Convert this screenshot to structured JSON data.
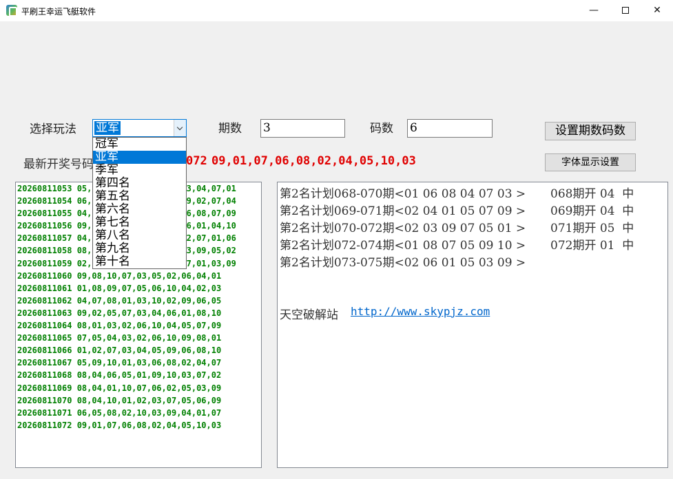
{
  "window": {
    "title": "平刷王幸运飞艇软件",
    "minimize_glyph": "—",
    "close_glyph": "✕"
  },
  "controls": {
    "play_label": "选择玩法",
    "play_selected": "亚军",
    "play_options": [
      "冠军",
      "亚军",
      "季军",
      "第四名",
      "第五名",
      "第六名",
      "第七名",
      "第八名",
      "第九名",
      "第十名"
    ],
    "periods_label": "期数",
    "periods_value": "3",
    "codes_label": "码数",
    "codes_value": "6",
    "set_button": "设置期数码数",
    "font_button": "字体显示设置"
  },
  "latest": {
    "label": "最新开奖号码",
    "issue_tail": "072",
    "numbers": "09,01,07,06,08,02,04,05,10,03",
    "color": "#e00000"
  },
  "history": [
    "20260811053 05,06,09,10,08,01,02,03,04,07,01",
    "20260811054 06,07,10,05,03,01,08,09,02,07,04",
    "20260811055 04,10,01,02,03,05,09,06,08,07,09",
    "20260811056 09,05,07,08,03,02,09,06,01,04,10",
    "20260811057 04,03,08,05,06,09,10,02,07,01,06",
    "20260811058 08,01,04,06,07,10,02,03,09,05,02",
    "20260811059 02,06,04,05,08,10,06,07,01,03,09",
    "20260811060 09,08,10,07,03,05,02,06,04,01",
    "20260811061 01,08,09,07,05,06,10,04,02,03",
    "20260811062 04,07,08,01,03,10,02,09,06,05",
    "20260811063 09,02,05,07,03,04,06,01,08,10",
    "20260811064 08,01,03,02,06,10,04,05,07,09",
    "20260811065 07,05,04,03,02,06,10,09,08,01",
    "20260811066 01,02,07,03,04,05,09,06,08,10",
    "20260811067 05,09,10,01,03,06,08,02,04,07",
    "20260811068 08,04,06,05,01,09,10,03,07,02",
    "20260811069 08,04,01,10,07,06,02,05,03,09",
    "20260811070 08,04,10,01,02,03,07,05,06,09",
    "20260811071 06,05,08,02,10,03,09,04,01,07",
    "20260811072 09,01,07,06,08,02,04,05,10,03"
  ],
  "history_color": "#008000",
  "plans": [
    {
      "plan": "第2名计划068-070期<01 06 08 04 07 03 >",
      "result": "068期开 04  中"
    },
    {
      "plan": "第2名计划069-071期<02 04 01 05 07 09 >",
      "result": "069期开 04  中"
    },
    {
      "plan": "第2名计划070-072期<02 03 09 07 05 01 >",
      "result": "071期开 05  中"
    },
    {
      "plan": "第2名计划072-074期<01 08 07 05 09 10 >",
      "result": "072期开 01  中"
    },
    {
      "plan": "第2名计划073-075期<02 06 01 05 03 09 >",
      "result": ""
    }
  ],
  "footer": {
    "label": "天空破解站",
    "link": "http://www.skypjz.com",
    "link_color": "#0066cc"
  }
}
